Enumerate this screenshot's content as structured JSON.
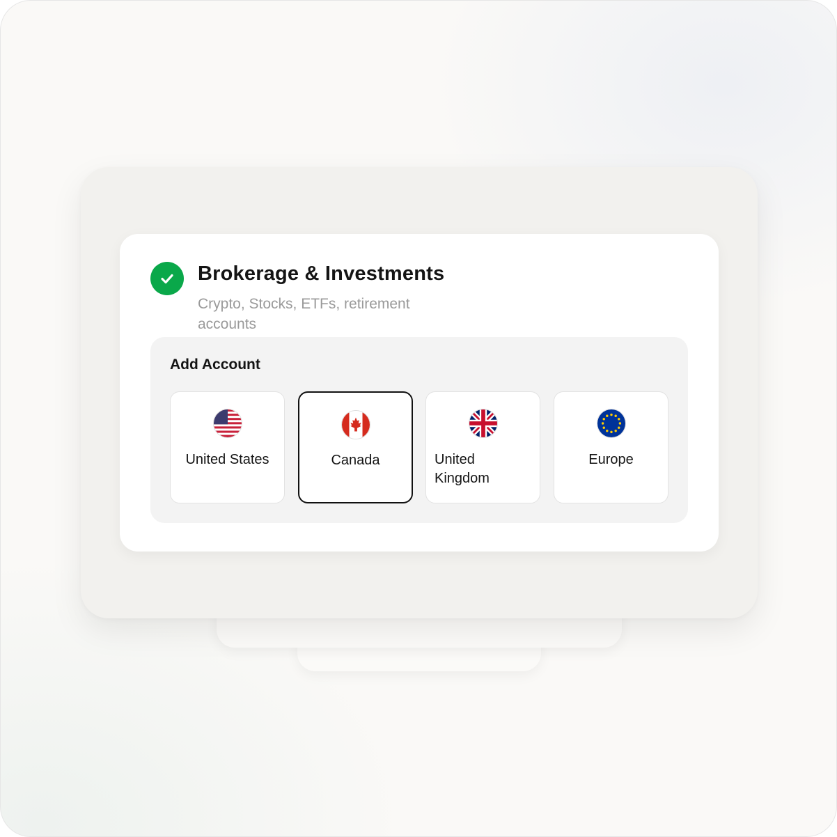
{
  "card": {
    "title": "Brokerage & Investments",
    "subtitle": "Crypto, Stocks, ETFs, retirement accounts",
    "status_icon": "check-circle-icon"
  },
  "add_account": {
    "title": "Add Account",
    "selected": "Canada",
    "options": [
      {
        "label": "United States",
        "icon": "us-flag-icon"
      },
      {
        "label": "Canada",
        "icon": "canada-flag-icon"
      },
      {
        "label": "United Kingdom",
        "icon": "uk-flag-icon"
      },
      {
        "label": "Europe",
        "icon": "eu-flag-icon"
      }
    ]
  },
  "colors": {
    "success": "#0aa84a",
    "selected_border": "#111111",
    "panel_bg": "#f3f3f3"
  }
}
